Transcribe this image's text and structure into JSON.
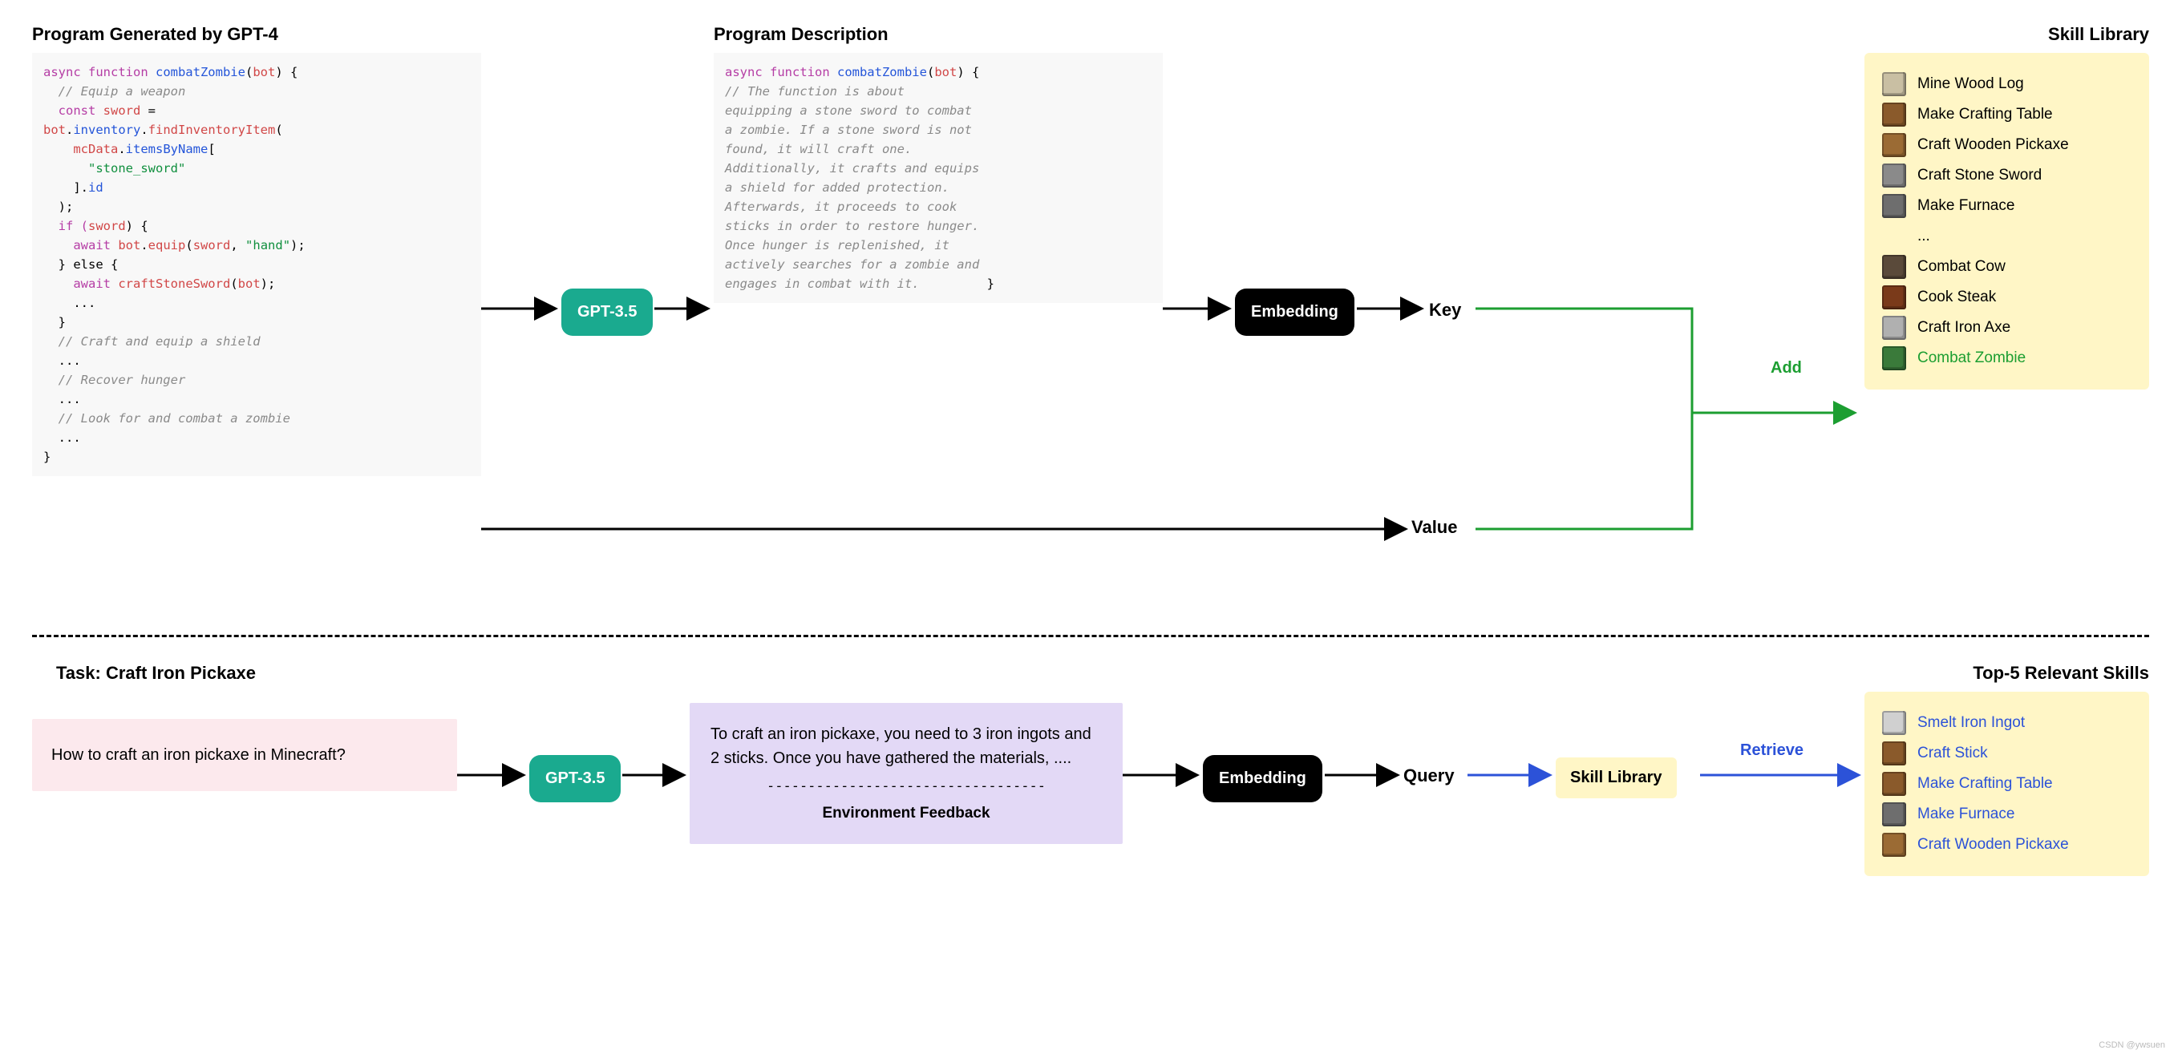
{
  "top": {
    "code_heading": "Program Generated by GPT-4",
    "desc_heading": "Program Description",
    "lib_heading": "Skill Library",
    "gpt_label": "GPT-3.5",
    "embed_label": "Embedding",
    "key_label": "Key",
    "value_label": "Value",
    "add_label": "Add",
    "code": {
      "l1a": "async function ",
      "l1b": "combatZombie",
      "l1c": "(",
      "l1d": "bot",
      "l1e": ") {",
      "l2": "  // Equip a weapon",
      "l3a": "  const ",
      "l3b": "sword",
      "l3c": " =",
      "l4a": "bot",
      "l4b": ".",
      "l4c": "inventory",
      "l4d": ".",
      "l4e": "findInventoryItem",
      "l4f": "(",
      "l5a": "    mcData",
      "l5b": ".",
      "l5c": "itemsByName",
      "l5d": "[",
      "l6": "      \"stone_sword\"",
      "l7a": "    ].",
      "l7b": "id",
      "l8": "  );",
      "l9a": "  if (",
      "l9b": "sword",
      "l9c": ") {",
      "l10a": "    await ",
      "l10b": "bot",
      "l10c": ".",
      "l10d": "equip",
      "l10e": "(",
      "l10f": "sword",
      "l10g": ", ",
      "l10h": "\"hand\"",
      "l10i": ");",
      "l11": "  } else {",
      "l12a": "    await ",
      "l12b": "craftStoneSword",
      "l12c": "(",
      "l12d": "bot",
      "l12e": ");",
      "l13": "    ...",
      "l14": "  }",
      "l15": "  // Craft and equip a shield",
      "l16": "  ...",
      "l17": "  // Recover hunger",
      "l18": "  ...",
      "l19": "  // Look for and combat a zombie",
      "l20": "  ...",
      "l21": "}"
    },
    "desc": {
      "l1a": "async function ",
      "l1b": "combatZombie",
      "l1c": "(",
      "l1d": "bot",
      "l1e": ") {",
      "body": "  // The function is about\nequipping a stone sword to combat\na zombie. If a stone sword is not\nfound, it will craft one.\nAdditionally, it crafts and equips\na shield for added protection.\nAfterwards, it proceeds to cook\nsticks in order to restore hunger.\nOnce hunger is replenished, it\nactively searches for a zombie and\nengages in combat with it.",
      "end": "}"
    },
    "skills": [
      {
        "name": "Mine Wood  Log",
        "color": "#c9bfa3"
      },
      {
        "name": "Make Crafting Table",
        "color": "#8a5a2b"
      },
      {
        "name": "Craft Wooden Pickaxe",
        "color": "#9b6b34"
      },
      {
        "name": "Craft Stone Sword",
        "color": "#8a8a8a"
      },
      {
        "name": "Make Furnace",
        "color": "#6e6e6e"
      },
      {
        "name": "...",
        "color": "transparent"
      },
      {
        "name": "Combat Cow",
        "color": "#5a4a3a"
      },
      {
        "name": "Cook Steak",
        "color": "#7a3a1a"
      },
      {
        "name": "Craft Iron Axe",
        "color": "#b0b0b0"
      },
      {
        "name": "Combat Zombie",
        "color": "#3a7a3a",
        "highlight": true
      }
    ]
  },
  "bottom": {
    "task_heading": "Task: Craft Iron Pickaxe",
    "top5_heading": "Top-5 Relevant Skills",
    "prompt": "How to craft an iron pickaxe in Minecraft?",
    "gpt_label": "GPT-3.5",
    "answer": "To craft an iron pickaxe, you need to 3 iron ingots and 2 sticks. Once you have gathered the materials, ....",
    "dashes": "----------------------------------",
    "env_label": "Environment Feedback",
    "embed_label": "Embedding",
    "query_label": "Query",
    "skill_lib_label": "Skill Library",
    "retrieve_label": "Retrieve",
    "skills": [
      {
        "name": "Smelt Iron Ingot",
        "color": "#d0d0d0"
      },
      {
        "name": "Craft Stick",
        "color": "#8a5a2b"
      },
      {
        "name": "Make Crafting Table",
        "color": "#8a5a2b"
      },
      {
        "name": "Make Furnace",
        "color": "#6e6e6e"
      },
      {
        "name": "Craft Wooden Pickaxe",
        "color": "#9b6b34"
      }
    ]
  },
  "watermark": "CSDN @ywsuen"
}
